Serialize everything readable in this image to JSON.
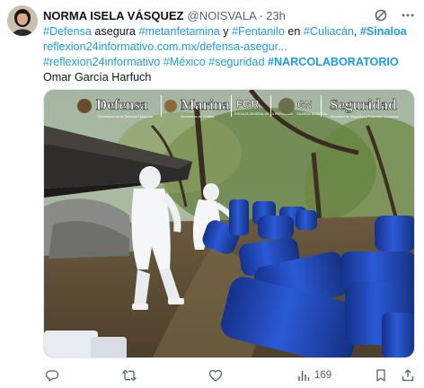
{
  "tweet": {
    "author": "NORMA ISELA VÁSQUEZ",
    "handle": "@NOISVALA",
    "separator": "·",
    "time": "23h",
    "line1": [
      {
        "text": "#Defensa",
        "link": true
      },
      {
        "text": " asegura ",
        "link": false
      },
      {
        "text": "#metanfetamina",
        "link": true
      },
      {
        "text": " y ",
        "link": false
      },
      {
        "text": "#Fentanilo",
        "link": true
      },
      {
        "text": " en ",
        "link": false
      },
      {
        "text": "#Culiacán",
        "link": true
      },
      {
        "text": ", ",
        "link": false
      },
      {
        "text": "#Sinaloa",
        "link": true,
        "bold": true
      }
    ],
    "line2_link": "reflexion24informativo.com.mx/defensa-asegur...",
    "line3": [
      {
        "text": "#reflexion24informativo",
        "link": true
      },
      {
        "text": " ",
        "link": false
      },
      {
        "text": "#México",
        "link": true
      },
      {
        "text": " ",
        "link": false
      },
      {
        "text": "#seguridad",
        "link": true
      },
      {
        "text": " ",
        "link": false
      },
      {
        "text": "#NARCOLABORATORIO",
        "link": true,
        "bold": true
      }
    ],
    "line4": "Omar García Harfuch"
  },
  "media": {
    "logos": {
      "defensa": "Defensa",
      "defensa_sub": "Secretaría de la Defensa Nacional",
      "marina": "Marina",
      "marina_sub": "Secretaría de Marina",
      "fgr": "FGR",
      "fgr_sub": "FISCALÍA GENERAL DE LA REPÚBLICA",
      "gn": "GN",
      "gn_sub": "GUARDIA NACIONAL",
      "seguridad": "Seguridad",
      "seguridad_sub": "Secretaría de Seguridad y Protección Ciudadana"
    }
  },
  "actions": {
    "views_count": "169"
  },
  "colors": {
    "link": "#1d9bf0",
    "text": "#0f1419",
    "muted": "#536471",
    "barrel_blue": "#1f45b8"
  },
  "icons": [
    "grok-icon",
    "more-icon",
    "reply-icon",
    "retweet-icon",
    "like-icon",
    "views-icon",
    "bookmark-icon",
    "share-icon"
  ]
}
